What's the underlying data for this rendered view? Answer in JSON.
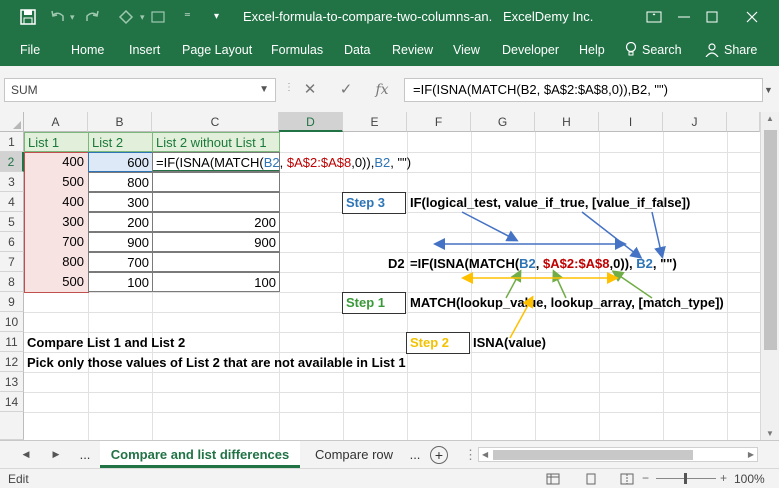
{
  "window": {
    "title": "Excel-formula-to-compare-two-columns-an...",
    "account": "ExcelDemy Inc."
  },
  "ribbon": {
    "tabs": [
      "File",
      "Home",
      "Insert",
      "Page Layout",
      "Formulas",
      "Data",
      "Review",
      "View",
      "Developer",
      "Help"
    ],
    "search": "Search",
    "share": "Share"
  },
  "formula_bar": {
    "name_box": "SUM",
    "cancel": "✕",
    "enter": "✓",
    "fx": "fx",
    "formula": "=IF(ISNA(MATCH(B2, $A$2:$A$8,0)),B2, \"\")"
  },
  "columns": [
    "A",
    "B",
    "C",
    "D",
    "E",
    "F",
    "G",
    "H",
    "I",
    "J"
  ],
  "rows": [
    "1",
    "2",
    "3",
    "4",
    "5",
    "6",
    "7",
    "8",
    "9",
    "10",
    "11",
    "12",
    "13",
    "14"
  ],
  "table": {
    "headers": [
      "List 1",
      "List 2",
      "List 2 without List 1"
    ],
    "list1": [
      "400",
      "500",
      "400",
      "300",
      "700",
      "800",
      "500"
    ],
    "list2": [
      "600",
      "800",
      "300",
      "200",
      "900",
      "700",
      "100"
    ],
    "result": [
      "",
      "",
      "",
      "200",
      "900",
      "",
      "100"
    ],
    "editing_formula": {
      "p1": "=IF(ISNA(MATCH(",
      "b2": "B2",
      "p2": ", ",
      "range": "$A$2:$A$8",
      "p3": ",0)),",
      "b2b": "B2",
      "p4": ", \"\")"
    }
  },
  "notes": {
    "line1": "Compare List 1 and List 2",
    "line2": "Pick only those values of List 2 that are not available in List 1"
  },
  "annotation": {
    "step3_label": "Step 3",
    "step3_text": "IF(logical_test, value_if_true, [value_if_false])",
    "d2_label": "D2",
    "formula": {
      "p1": "=IF(ISNA(MATCH(",
      "b2": "B2",
      "p2": ", ",
      "range": "$A$2:$A$8",
      "p3": ",0)), ",
      "b2b": "B2",
      "p4": ", \"\")"
    },
    "step1_label": "Step 1",
    "step1_text": "MATCH(lookup_value, lookup_array, [match_type])",
    "step2_label": "Step 2",
    "step2_text": "ISNA(value)"
  },
  "sheets": {
    "nav_prev": "◀",
    "nav_next": "▶",
    "more": "...",
    "active": "Compare and list differences",
    "other": "Compare row",
    "more_right": "...",
    "add": "+"
  },
  "status": {
    "mode": "Edit",
    "zoom": "100%"
  },
  "colors": {
    "excel_green": "#217346",
    "blue_ref": "#2e75b6",
    "red_ref": "#c00000",
    "step3_color": "#2e75b6",
    "step1_color": "#3a9a3a",
    "step2_color": "#f2c200"
  }
}
